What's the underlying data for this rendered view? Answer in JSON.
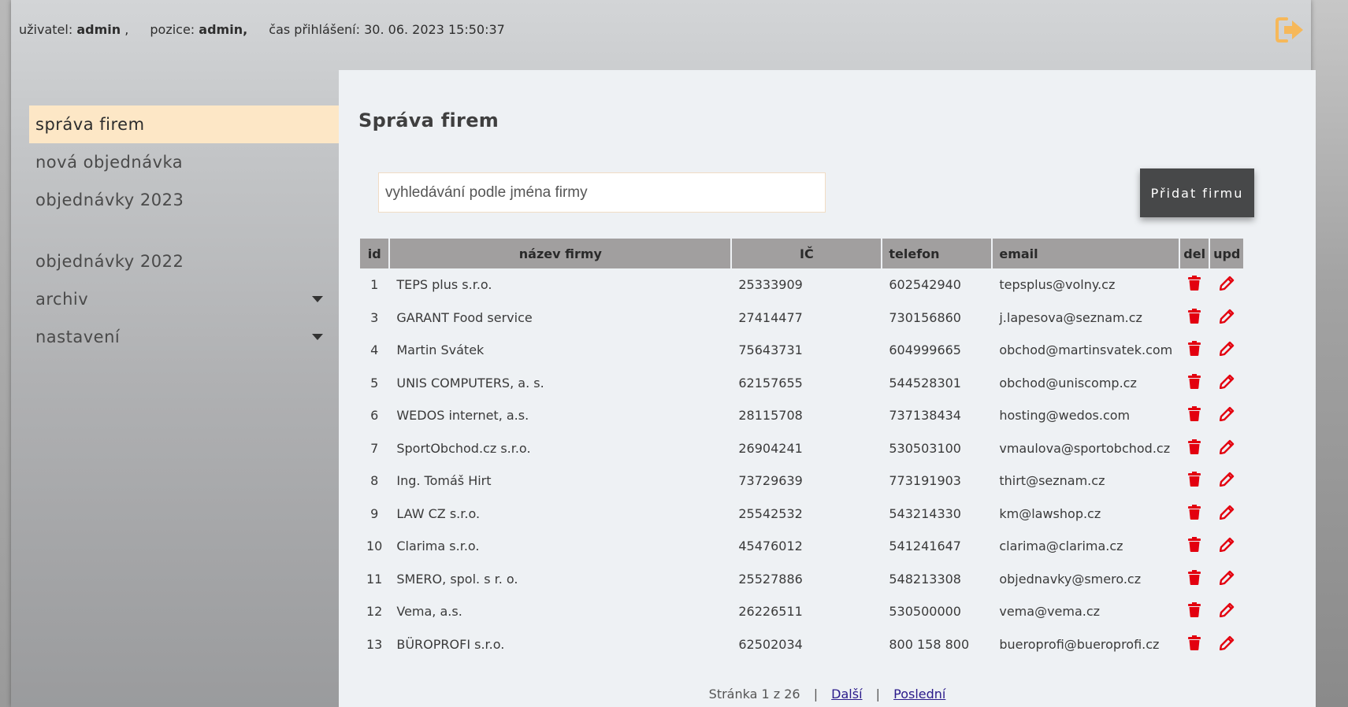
{
  "header": {
    "user_label": "uživatel:",
    "user_value": "admin",
    "role_label": "pozice:",
    "role_value": "admin,",
    "login_label": "čas přihlášení:",
    "login_value": "30. 06. 2023 15:50:37",
    "logout_icon": "sign-out-icon"
  },
  "sidebar": {
    "items": [
      {
        "label": "správa firem",
        "active": true
      },
      {
        "label": "nová objednávka"
      },
      {
        "label": "objednávky 2023"
      },
      {
        "label": "objednávky 2022"
      },
      {
        "label": "archiv",
        "has_submenu": true
      },
      {
        "label": "nastavení",
        "has_submenu": true
      }
    ]
  },
  "main": {
    "title": "Správa firem",
    "search_placeholder": "vyhledávání podle jména firmy",
    "add_button": "Přidat firmu",
    "columns": [
      "id",
      "název firmy",
      "IČ",
      "telefon",
      "email",
      "del",
      "upd"
    ],
    "rows": [
      {
        "id": "1",
        "name": "TEPS plus s.r.o.",
        "ic": "25333909",
        "phone": "602542940",
        "email": "tepsplus@volny.cz"
      },
      {
        "id": "3",
        "name": "GARANT Food service",
        "ic": "27414477",
        "phone": "730156860",
        "email": "j.lapesova@seznam.cz"
      },
      {
        "id": "4",
        "name": "Martin Svátek",
        "ic": "75643731",
        "phone": "604999665",
        "email": "obchod@martinsvatek.com"
      },
      {
        "id": "5",
        "name": "UNIS COMPUTERS, a. s.",
        "ic": "62157655",
        "phone": "544528301",
        "email": "obchod@uniscomp.cz"
      },
      {
        "id": "6",
        "name": "WEDOS internet, a.s.",
        "ic": "28115708",
        "phone": "737138434",
        "email": "hosting@wedos.com"
      },
      {
        "id": "7",
        "name": "SportObchod.cz s.r.o.",
        "ic": "26904241",
        "phone": "530503100",
        "email": "vmaulova@sportobchod.cz"
      },
      {
        "id": "8",
        "name": "Ing. Tomáš Hirt",
        "ic": "73729639",
        "phone": "773191903",
        "email": "thirt@seznam.cz"
      },
      {
        "id": "9",
        "name": "LAW CZ s.r.o.",
        "ic": "25542532",
        "phone": "543214330",
        "email": "km@lawshop.cz"
      },
      {
        "id": "10",
        "name": "Clarima s.r.o.",
        "ic": "45476012",
        "phone": "541241647",
        "email": "clarima@clarima.cz"
      },
      {
        "id": "11",
        "name": "SMERO, spol. s r. o.",
        "ic": "25527886",
        "phone": "548213308",
        "email": "objednavky@smero.cz"
      },
      {
        "id": "12",
        "name": "Vema, a.s.",
        "ic": "26226511",
        "phone": "530500000",
        "email": "vema@vema.cz"
      },
      {
        "id": "13",
        "name": "BÜROPROFI s.r.o.",
        "ic": "62502034",
        "phone": "800 158 800",
        "email": "bueroprofi@bueroprofi.cz"
      }
    ],
    "row_icons": {
      "delete": "trash-icon",
      "update": "pencil-icon",
      "color": "#e3000f"
    },
    "pager": {
      "text": "Stránka 1 z 26",
      "separator": "|",
      "next": "Další",
      "last": "Poslední"
    }
  },
  "colors": {
    "active_nav": "#fde7c6",
    "header_cell": "#a19f9f",
    "button": "#474849",
    "logout_icon": "#f6b85a"
  }
}
